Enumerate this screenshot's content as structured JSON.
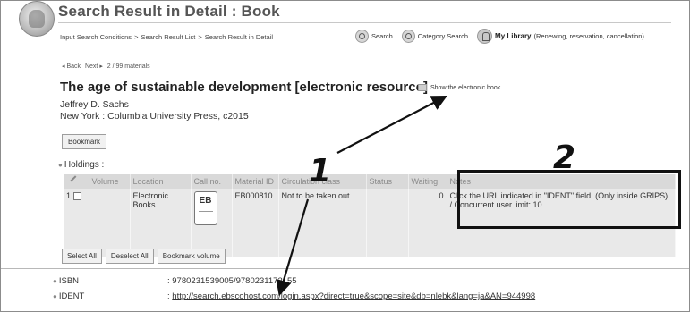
{
  "header": {
    "title": "Search Result in Detail : Book",
    "logo": "owl-logo"
  },
  "breadcrumb": {
    "items": [
      "Input Search Conditions",
      "Search Result List",
      "Search Result in Detail"
    ],
    "separator": ">"
  },
  "topnav": {
    "search": "Search",
    "category_search": "Category Search",
    "my_library": "My Library",
    "my_library_note": "(Renewing, reservation, cancellation)"
  },
  "pager": {
    "back": "◂ Back",
    "next": "Next ▸",
    "position": "2 / 99 materials"
  },
  "record": {
    "title": "The age of sustainable development [electronic resource]",
    "show_ebook": "Show the electronic book",
    "author": "Jeffrey D. Sachs",
    "publisher": "New York : Columbia University Press, c2015",
    "bookmark_button": "Bookmark"
  },
  "holdings": {
    "heading": "Holdings :",
    "columns": [
      "",
      "Volume",
      "Location",
      "Call no.",
      "Material ID",
      "Circulation class",
      "Status",
      "Waiting",
      "Notes"
    ],
    "row": {
      "index": "1",
      "volume": "",
      "location": "Electronic Books",
      "call_no": "EB",
      "material_id": "EB000810",
      "circulation_class": "Not to be taken out",
      "status": "",
      "waiting": "0",
      "notes": "Click the URL indicated in \"IDENT\" field. (Only inside GRIPS) / Concurrent user limit: 10"
    }
  },
  "actions": {
    "select_all": "Select All",
    "deselect_all": "Deselect All",
    "bookmark_volume": "Bookmark volume"
  },
  "identifiers": {
    "isbn_label": "ISBN",
    "isbn_value": ": 9780231539005/9780231173155",
    "ident_label": "IDENT",
    "ident_colon": ": ",
    "ident_url": "http://search.ebscohost.com/login.aspx?direct=true&scope=site&db=nlebk&lang=ja&AN=944998"
  },
  "annotations": {
    "marker_1": "1",
    "marker_2": "2"
  },
  "colors": {
    "header_text": "#555555",
    "table_header_bg": "#d9d9d9",
    "table_row_bg": "#e9e9e9",
    "annotation": "#111111"
  }
}
